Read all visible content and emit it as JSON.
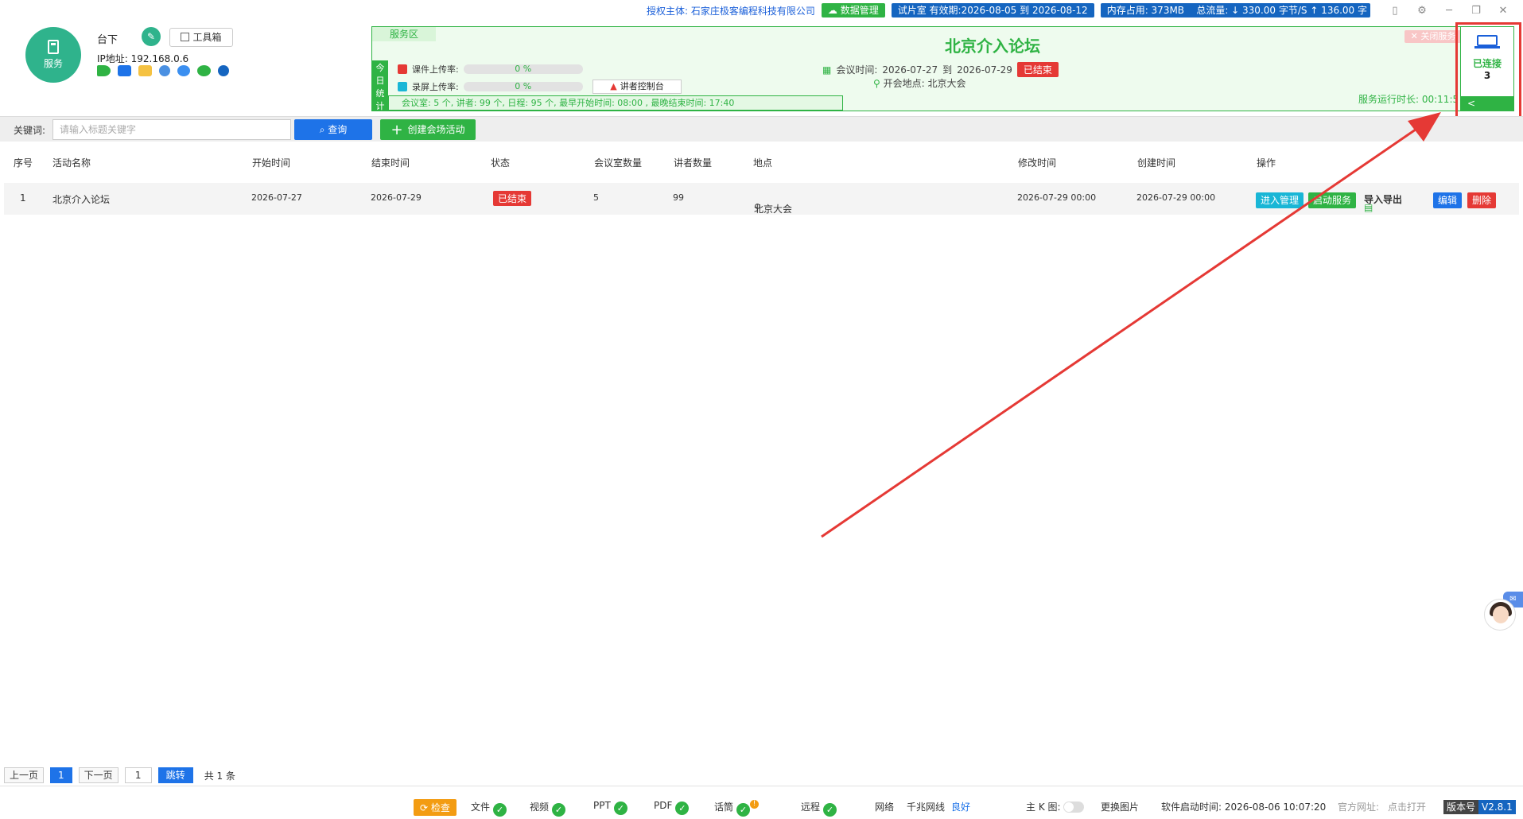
{
  "topbar": {
    "auth_prefix": "授权主体:",
    "auth_company": "石家庄极客编程科技有限公司",
    "data_mgmt": "数据管理",
    "trial": "试片室 有效期:2026-08-05 到 2026-08-12",
    "memory": "内存占用:   373MB",
    "traffic": "总流量:  ↓ 330.00 字节/S     ↑ 136.00 字"
  },
  "profile": {
    "avatar_label": "服务",
    "name": "台下",
    "toolbox": "工具箱",
    "ip": "IP地址: 192.168.0.6",
    "icons": [
      "speaker-icon",
      "monitor-icon",
      "folder-icon",
      "chrome-icon",
      "globe-icon",
      "wechat-icon",
      "qq-icon"
    ]
  },
  "service": {
    "tab": "服务区",
    "stat_label": "今日统计",
    "courseware_label": "课件上传率:",
    "courseware_pct": "0 %",
    "record_label": "录屏上传率:",
    "record_pct": "0 %",
    "speaker_console": "讲者控制台",
    "stats": "会议室:   5 个,  讲者:   99 个,  日程:   95 个,  最早开始时间:   08:00 ,     最晚结束时间:   17:40",
    "title": "北京介入论坛",
    "meeting_time_label": "会议时间:",
    "start": "2026-07-27",
    "to": "到",
    "end": "2026-07-29",
    "status": "已结束",
    "location": "开会地点:   北京大会",
    "close_service": "✕ 关闭服务",
    "run_time": "服务运行时长: 00:11:5",
    "connected_label": "已连接",
    "connected_count": "3",
    "collapse": "<"
  },
  "search": {
    "label": "关键词:",
    "placeholder": "请输入标题关键字",
    "query": "查询",
    "create": "创建会场活动"
  },
  "table": {
    "headers": [
      "序号",
      "活动名称",
      "开始时间",
      "结束时间",
      "状态",
      "会议室数量",
      "讲者数量",
      "地点",
      "修改时间",
      "创建时间",
      "操作"
    ],
    "rows": [
      {
        "index": "1",
        "name": "北京介入论坛",
        "start": "2026-07-27",
        "end": "2026-07-29",
        "status": "已结束",
        "rooms": "5",
        "speakers": "99",
        "location": "北京大会",
        "modified": "2026-07-29 00:00",
        "created": "2026-07-29 00:00",
        "actions": {
          "manage": "进入管理",
          "start_service": "启动服务",
          "import_export": "导入导出",
          "edit": "编辑",
          "delete": "删除"
        }
      }
    ]
  },
  "pager": {
    "prev": "上一页",
    "current": "1",
    "next": "下一页",
    "input": "1",
    "jump": "跳转",
    "total": "共 1 条"
  },
  "status": {
    "check": "检查",
    "file": "文件",
    "video": "视频",
    "ppt": "PPT",
    "pdf": "PDF",
    "mic": "话筒",
    "remote": "远程",
    "network": "网络",
    "net_type": "千兆网线",
    "net_quality": "良好",
    "kmap": "主 K 图:",
    "change_image": "更换图片",
    "launch_time": "软件启动时间:  2026-08-06 10:07:20",
    "website": "官方网址:",
    "website_link": "点击打开",
    "version_label": "版本号",
    "version": "V2.8.1"
  },
  "colors": {
    "green": "#2fb344",
    "blue": "#1e73e8",
    "red": "#e53935",
    "cyan": "#19b6d6",
    "orange": "#f39c12"
  }
}
